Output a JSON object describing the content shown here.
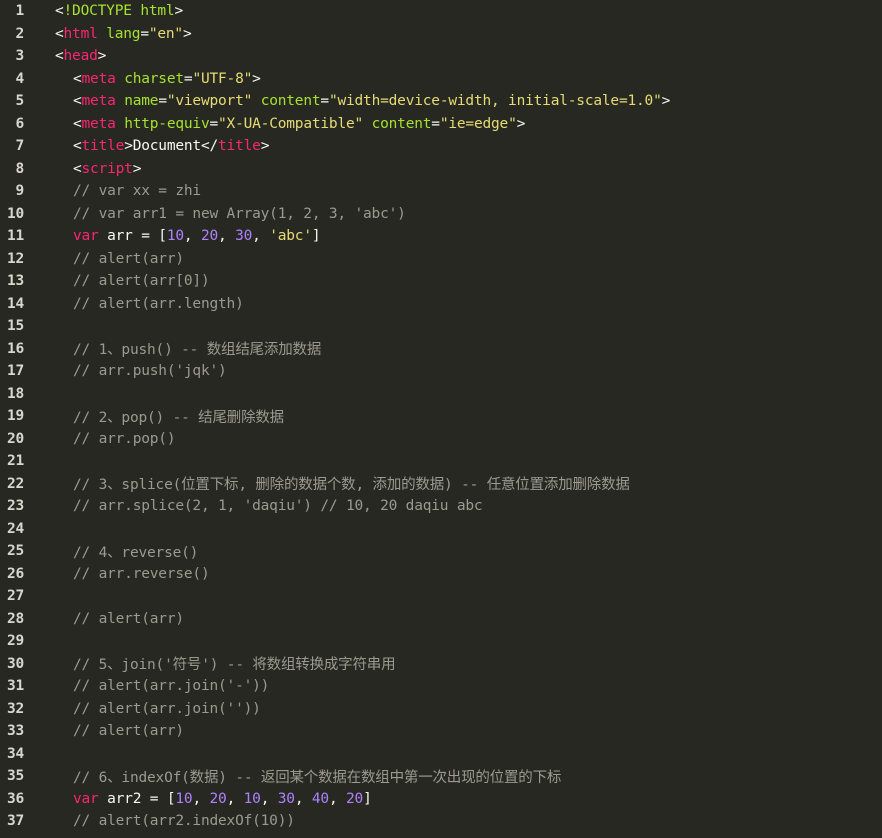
{
  "editor": {
    "theme": {
      "background": "#272822",
      "text": "#f8f8f2",
      "tag": "#f92672",
      "attr": "#a6e22e",
      "string": "#e6db74",
      "comment": "#9a9a90",
      "number": "#ae81ff",
      "line_number": "#d7d7ce"
    },
    "lines": [
      {
        "n": "1",
        "indent": 0,
        "tokens": [
          [
            "punc",
            "<"
          ],
          [
            "doctype",
            "!DOCTYPE"
          ],
          [
            "text",
            " "
          ],
          [
            "attr",
            "html"
          ],
          [
            "punc",
            ">"
          ]
        ]
      },
      {
        "n": "2",
        "indent": 0,
        "tokens": [
          [
            "punc",
            "<"
          ],
          [
            "tag",
            "html"
          ],
          [
            "text",
            " "
          ],
          [
            "attr",
            "lang"
          ],
          [
            "punc",
            "="
          ],
          [
            "str",
            "\"en\""
          ],
          [
            "punc",
            ">"
          ]
        ]
      },
      {
        "n": "3",
        "indent": 0,
        "tokens": [
          [
            "punc",
            "<"
          ],
          [
            "tag",
            "head"
          ],
          [
            "punc",
            ">"
          ]
        ]
      },
      {
        "n": "4",
        "indent": 1,
        "tokens": [
          [
            "punc",
            "<"
          ],
          [
            "tag",
            "meta"
          ],
          [
            "text",
            " "
          ],
          [
            "attr",
            "charset"
          ],
          [
            "punc",
            "="
          ],
          [
            "str",
            "\"UTF-8\""
          ],
          [
            "punc",
            ">"
          ]
        ]
      },
      {
        "n": "5",
        "indent": 1,
        "tokens": [
          [
            "punc",
            "<"
          ],
          [
            "tag",
            "meta"
          ],
          [
            "text",
            " "
          ],
          [
            "attr",
            "name"
          ],
          [
            "punc",
            "="
          ],
          [
            "str",
            "\"viewport\""
          ],
          [
            "text",
            " "
          ],
          [
            "attr",
            "content"
          ],
          [
            "punc",
            "="
          ],
          [
            "str",
            "\"width=device-width, initial-scale=1.0\""
          ],
          [
            "punc",
            ">"
          ]
        ]
      },
      {
        "n": "6",
        "indent": 1,
        "tokens": [
          [
            "punc",
            "<"
          ],
          [
            "tag",
            "meta"
          ],
          [
            "text",
            " "
          ],
          [
            "attr",
            "http-equiv"
          ],
          [
            "punc",
            "="
          ],
          [
            "str",
            "\"X-UA-Compatible\""
          ],
          [
            "text",
            " "
          ],
          [
            "attr",
            "content"
          ],
          [
            "punc",
            "="
          ],
          [
            "str",
            "\"ie=edge\""
          ],
          [
            "punc",
            ">"
          ]
        ]
      },
      {
        "n": "7",
        "indent": 1,
        "tokens": [
          [
            "punc",
            "<"
          ],
          [
            "tag",
            "title"
          ],
          [
            "punc",
            ">"
          ],
          [
            "text",
            "Document"
          ],
          [
            "punc",
            "</"
          ],
          [
            "tag",
            "title"
          ],
          [
            "punc",
            ">"
          ]
        ]
      },
      {
        "n": "8",
        "indent": 1,
        "tokens": [
          [
            "punc",
            "<"
          ],
          [
            "tag",
            "script"
          ],
          [
            "punc",
            ">"
          ]
        ]
      },
      {
        "n": "9",
        "indent": 1,
        "tokens": [
          [
            "cmt",
            "// var xx = zhi"
          ]
        ]
      },
      {
        "n": "10",
        "indent": 1,
        "tokens": [
          [
            "cmt",
            "// var arr1 = new Array(1, 2, 3, 'abc')"
          ]
        ]
      },
      {
        "n": "11",
        "indent": 1,
        "tokens": [
          [
            "kw",
            "var"
          ],
          [
            "text",
            " arr = ["
          ],
          [
            "num",
            "10"
          ],
          [
            "text",
            ", "
          ],
          [
            "num",
            "20"
          ],
          [
            "text",
            ", "
          ],
          [
            "num",
            "30"
          ],
          [
            "text",
            ", "
          ],
          [
            "str",
            "'abc'"
          ],
          [
            "text",
            "]"
          ]
        ]
      },
      {
        "n": "12",
        "indent": 1,
        "tokens": [
          [
            "cmt",
            "// alert(arr)"
          ]
        ]
      },
      {
        "n": "13",
        "indent": 1,
        "tokens": [
          [
            "cmt",
            "// alert(arr[0])"
          ]
        ]
      },
      {
        "n": "14",
        "indent": 1,
        "tokens": [
          [
            "cmt",
            "// alert(arr.length)"
          ]
        ]
      },
      {
        "n": "15",
        "indent": 0,
        "tokens": []
      },
      {
        "n": "16",
        "indent": 1,
        "tokens": [
          [
            "cmt",
            "// 1、push() -- 数组结尾添加数据"
          ]
        ]
      },
      {
        "n": "17",
        "indent": 1,
        "tokens": [
          [
            "cmt",
            "// arr.push('jqk')"
          ]
        ]
      },
      {
        "n": "18",
        "indent": 0,
        "tokens": []
      },
      {
        "n": "19",
        "indent": 1,
        "tokens": [
          [
            "cmt",
            "// 2、pop() -- 结尾删除数据"
          ]
        ]
      },
      {
        "n": "20",
        "indent": 1,
        "tokens": [
          [
            "cmt",
            "// arr.pop()"
          ]
        ]
      },
      {
        "n": "21",
        "indent": 0,
        "tokens": []
      },
      {
        "n": "22",
        "indent": 1,
        "tokens": [
          [
            "cmt",
            "// 3、splice(位置下标, 删除的数据个数, 添加的数据) -- 任意位置添加删除数据"
          ]
        ]
      },
      {
        "n": "23",
        "indent": 1,
        "tokens": [
          [
            "cmt",
            "// arr.splice(2, 1, 'daqiu') // 10, 20 daqiu abc"
          ]
        ]
      },
      {
        "n": "24",
        "indent": 0,
        "tokens": []
      },
      {
        "n": "25",
        "indent": 1,
        "tokens": [
          [
            "cmt",
            "// 4、reverse()"
          ]
        ]
      },
      {
        "n": "26",
        "indent": 1,
        "tokens": [
          [
            "cmt",
            "// arr.reverse()"
          ]
        ]
      },
      {
        "n": "27",
        "indent": 0,
        "tokens": []
      },
      {
        "n": "28",
        "indent": 1,
        "tokens": [
          [
            "cmt",
            "// alert(arr)"
          ]
        ]
      },
      {
        "n": "29",
        "indent": 0,
        "tokens": []
      },
      {
        "n": "30",
        "indent": 1,
        "tokens": [
          [
            "cmt",
            "// 5、join('符号') -- 将数组转换成字符串用"
          ]
        ]
      },
      {
        "n": "31",
        "indent": 1,
        "tokens": [
          [
            "cmt",
            "// alert(arr.join('-'))"
          ]
        ]
      },
      {
        "n": "32",
        "indent": 1,
        "tokens": [
          [
            "cmt",
            "// alert(arr.join(''))"
          ]
        ]
      },
      {
        "n": "33",
        "indent": 1,
        "tokens": [
          [
            "cmt",
            "// alert(arr)"
          ]
        ]
      },
      {
        "n": "34",
        "indent": 0,
        "tokens": []
      },
      {
        "n": "35",
        "indent": 1,
        "tokens": [
          [
            "cmt",
            "// 6、indexOf(数据) -- 返回某个数据在数组中第一次出现的位置的下标"
          ]
        ]
      },
      {
        "n": "36",
        "indent": 1,
        "tokens": [
          [
            "kw",
            "var"
          ],
          [
            "text",
            " arr2 = ["
          ],
          [
            "num",
            "10"
          ],
          [
            "text",
            ", "
          ],
          [
            "num",
            "20"
          ],
          [
            "text",
            ", "
          ],
          [
            "num",
            "10"
          ],
          [
            "text",
            ", "
          ],
          [
            "num",
            "30"
          ],
          [
            "text",
            ", "
          ],
          [
            "num",
            "40"
          ],
          [
            "text",
            ", "
          ],
          [
            "num",
            "20"
          ],
          [
            "text",
            "]"
          ]
        ]
      },
      {
        "n": "37",
        "indent": 1,
        "tokens": [
          [
            "cmt",
            "// alert(arr2.indexOf(10))"
          ]
        ]
      }
    ]
  }
}
